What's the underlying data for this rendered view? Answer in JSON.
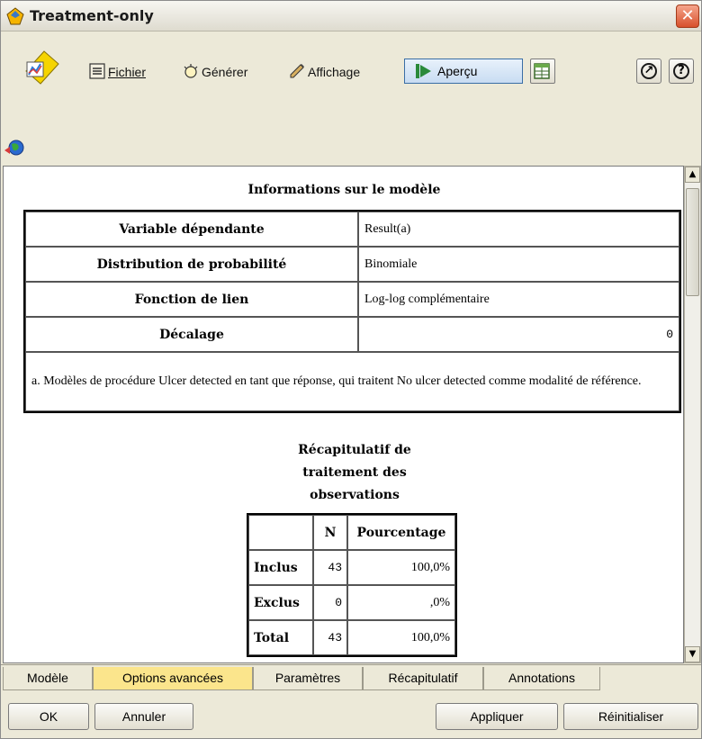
{
  "window": {
    "title": "Treatment-only"
  },
  "toolbar": {
    "menu": [
      {
        "label": "Fichier",
        "underline": "F"
      },
      {
        "label": "Générer",
        "underline": "G"
      },
      {
        "label": "Affichage"
      }
    ],
    "preview_label": "Aperçu"
  },
  "content": {
    "model_info": {
      "title": "Informations sur le modèle",
      "rows": [
        {
          "label": "Variable dépendante",
          "value": "Result(a)"
        },
        {
          "label": "Distribution de probabilité",
          "value": "Binomiale"
        },
        {
          "label": "Fonction de lien",
          "value": "Log-log complémentaire"
        },
        {
          "label": "Décalage",
          "value": "0"
        }
      ],
      "footnote": "a. Modèles de procédure Ulcer detected en tant que réponse, qui traitent No ulcer detected comme modalité de référence."
    },
    "case_summary": {
      "title_lines": [
        "Récapitulatif de",
        "traitement des",
        "observations"
      ],
      "headers": [
        "",
        "N",
        "Pourcentage"
      ],
      "rows": [
        {
          "label": "Inclus",
          "n": "43",
          "pct": "100,0%"
        },
        {
          "label": "Exclus",
          "n": "0",
          "pct": ",0%"
        },
        {
          "label": "Total",
          "n": "43",
          "pct": "100,0%"
        }
      ]
    }
  },
  "tabs": [
    {
      "label": "Modèle",
      "active": false
    },
    {
      "label": "Options avancées",
      "active": true
    },
    {
      "label": "Paramètres",
      "active": false
    },
    {
      "label": "Récapitulatif",
      "active": false
    },
    {
      "label": "Annotations",
      "active": false
    }
  ],
  "buttons": {
    "ok": "OK",
    "cancel": "Annuler",
    "apply": "Appliquer",
    "reset": "Réinitialiser"
  },
  "colors": {
    "active_tab": "#fbe58c",
    "close_button": "#d8502c",
    "preview_button": "#c8dcf2"
  }
}
